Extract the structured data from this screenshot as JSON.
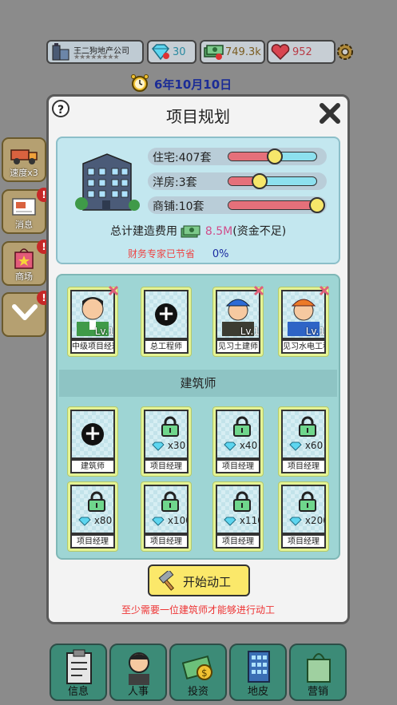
{
  "topbar": {
    "company_name": "王二狗地产公司",
    "stars": "★★★★★★★★",
    "gems": "30",
    "cash": "749.3k",
    "hearts": "952"
  },
  "date": "6年10月10日",
  "sidebar": [
    {
      "label": "速度x3",
      "icon": "truck-icon",
      "badge": ""
    },
    {
      "label": "消息",
      "icon": "mail-icon",
      "badge": "!"
    },
    {
      "label": "商场",
      "icon": "shopping-bag-icon",
      "badge": "!"
    },
    {
      "label": "",
      "icon": "chevron-down-icon",
      "badge": "!"
    }
  ],
  "modal": {
    "title": "项目规划",
    "sliders": [
      {
        "label": "住宅:407套",
        "level": 0.53
      },
      {
        "label": "洋房:3套",
        "level": 0.36
      },
      {
        "label": "商铺:10套",
        "level": 1.0
      }
    ],
    "cost_label": "总计建造费用",
    "cost_value": "8.5M",
    "cost_note": "(资金不足)",
    "savings_label": "财务专家已节省",
    "savings_value": "0%",
    "staff": [
      {
        "caption": "中级项目经理",
        "level": "Lv.1",
        "type": "person-manager"
      },
      {
        "caption": "总工程师",
        "level": "",
        "type": "add"
      },
      {
        "caption": "见习土建师",
        "level": "Lv.1",
        "type": "person-civil"
      },
      {
        "caption": "见习水电工程",
        "level": "Lv.1",
        "type": "person-electric"
      }
    ],
    "section_label": "建筑师",
    "architects": [
      {
        "caption": "建筑师",
        "price": "",
        "type": "add"
      },
      {
        "caption": "项目经理",
        "price": "x30",
        "type": "locked"
      },
      {
        "caption": "项目经理",
        "price": "x40",
        "type": "locked"
      },
      {
        "caption": "项目经理",
        "price": "x60",
        "type": "locked"
      },
      {
        "caption": "项目经理",
        "price": "x80",
        "type": "locked"
      },
      {
        "caption": "项目经理",
        "price": "x100",
        "type": "locked"
      },
      {
        "caption": "项目经理",
        "price": "x110",
        "type": "locked"
      },
      {
        "caption": "项目经理",
        "price": "x200",
        "type": "locked"
      }
    ],
    "start_label": "开始动工",
    "warning": "至少需要一位建筑师才能够进行动工"
  },
  "bottom_nav": [
    {
      "label": "信息",
      "icon": "clipboard-icon"
    },
    {
      "label": "人事",
      "icon": "person-icon"
    },
    {
      "label": "投资",
      "icon": "money-icon"
    },
    {
      "label": "地皮",
      "icon": "building-icon"
    },
    {
      "label": "营销",
      "icon": "bag-icon"
    }
  ],
  "colors": {
    "accent": "#1b2c96",
    "panel": "#c3e7ef",
    "grid_panel": "#9ed5d4",
    "slot": "#e4f394",
    "warning": "#e33333",
    "button": "#fbe86a"
  }
}
